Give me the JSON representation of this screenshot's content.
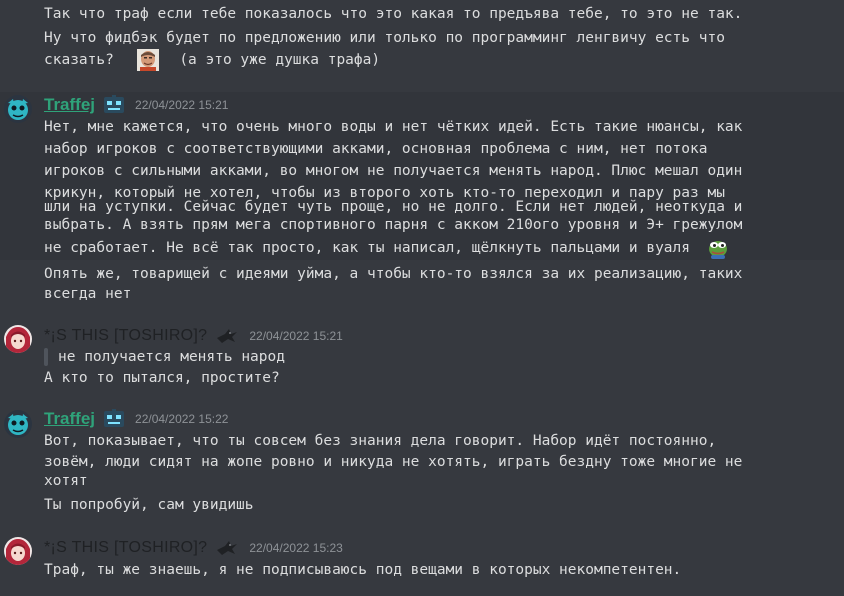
{
  "messages_top": {
    "line1": "Так что траф если тебе показалось что это какая то предъява тебе, то это не так.",
    "line2": "Ну что фидбэк будет по предложению или только по программинг ленгвичу есть что",
    "line3_pre": "сказать?",
    "line3_post": "(а это уже душка трафа)"
  },
  "msg1": {
    "username": "Traffej",
    "timestamp": "22/04/2022 15:21",
    "lines": [
      "Нет, мне кажется, что очень много воды и нет чётких идей. Есть такие нюансы, как",
      "набор игроков с соответствующими акками, основная проблема с ним, нет потока",
      "игроков с сильными акками, во многом не получается менять народ. Плюс мешал один",
      "крикун, который не хотел, чтобы из второго хоть кто-то переходил и пару раз мы",
      "шли на уступки. Сейчас будет чуть проще, но не долго. Если нет людей, неоткуда и",
      "выбрать. А взять прям мега спортивного парня с акком 210ого уровня и Э+ грежулом",
      "не сработает. Не всё так просто, как ты написал, щёлкнуть пальцами и вуаля"
    ],
    "follow_lines": [
      "Опять же, товарищей с идеями уйма, а чтобы кто-то взялся за их реализацию, таких",
      "всегда нет"
    ]
  },
  "msg2": {
    "username": "*¡S THIS [TOSHIRO]?",
    "timestamp": "22/04/2022 15:21",
    "quote": "не получается менять народ",
    "lines": [
      "А кто то пытался, простите?"
    ]
  },
  "msg3": {
    "username": "Traffej",
    "timestamp": "22/04/2022 15:22",
    "lines": [
      "Вот, показывает, что ты совсем без знания дела говорит. Набор идёт постоянно,",
      "зовём, люди сидят на жопе ровно и никуда не хотять, играть бездну тоже многие не",
      "хотят"
    ],
    "follow_lines": [
      "Ты попробуй, сам увидишь"
    ]
  },
  "msg4": {
    "username": "*¡S THIS [TOSHIRO]?",
    "timestamp": "22/04/2022 15:23",
    "lines": [
      "Траф, ты же знаешь, я не подписываюсь под вещами в которых некомпетентен."
    ]
  },
  "colors": {
    "background": "#36393f",
    "text": "#dcddde",
    "username_green": "#2fa37a",
    "timestamp": "#8e9297"
  },
  "icons": {
    "avatar_traffej": "cyan-mascot-avatar",
    "avatar_toshiro": "red-anime-avatar",
    "badge_traffej": "robot-face-badge",
    "badge_toshiro": "bird-badge",
    "emoji_face": "meme-face-emoji",
    "emoji_pepe": "pepe-frog-emoji"
  }
}
